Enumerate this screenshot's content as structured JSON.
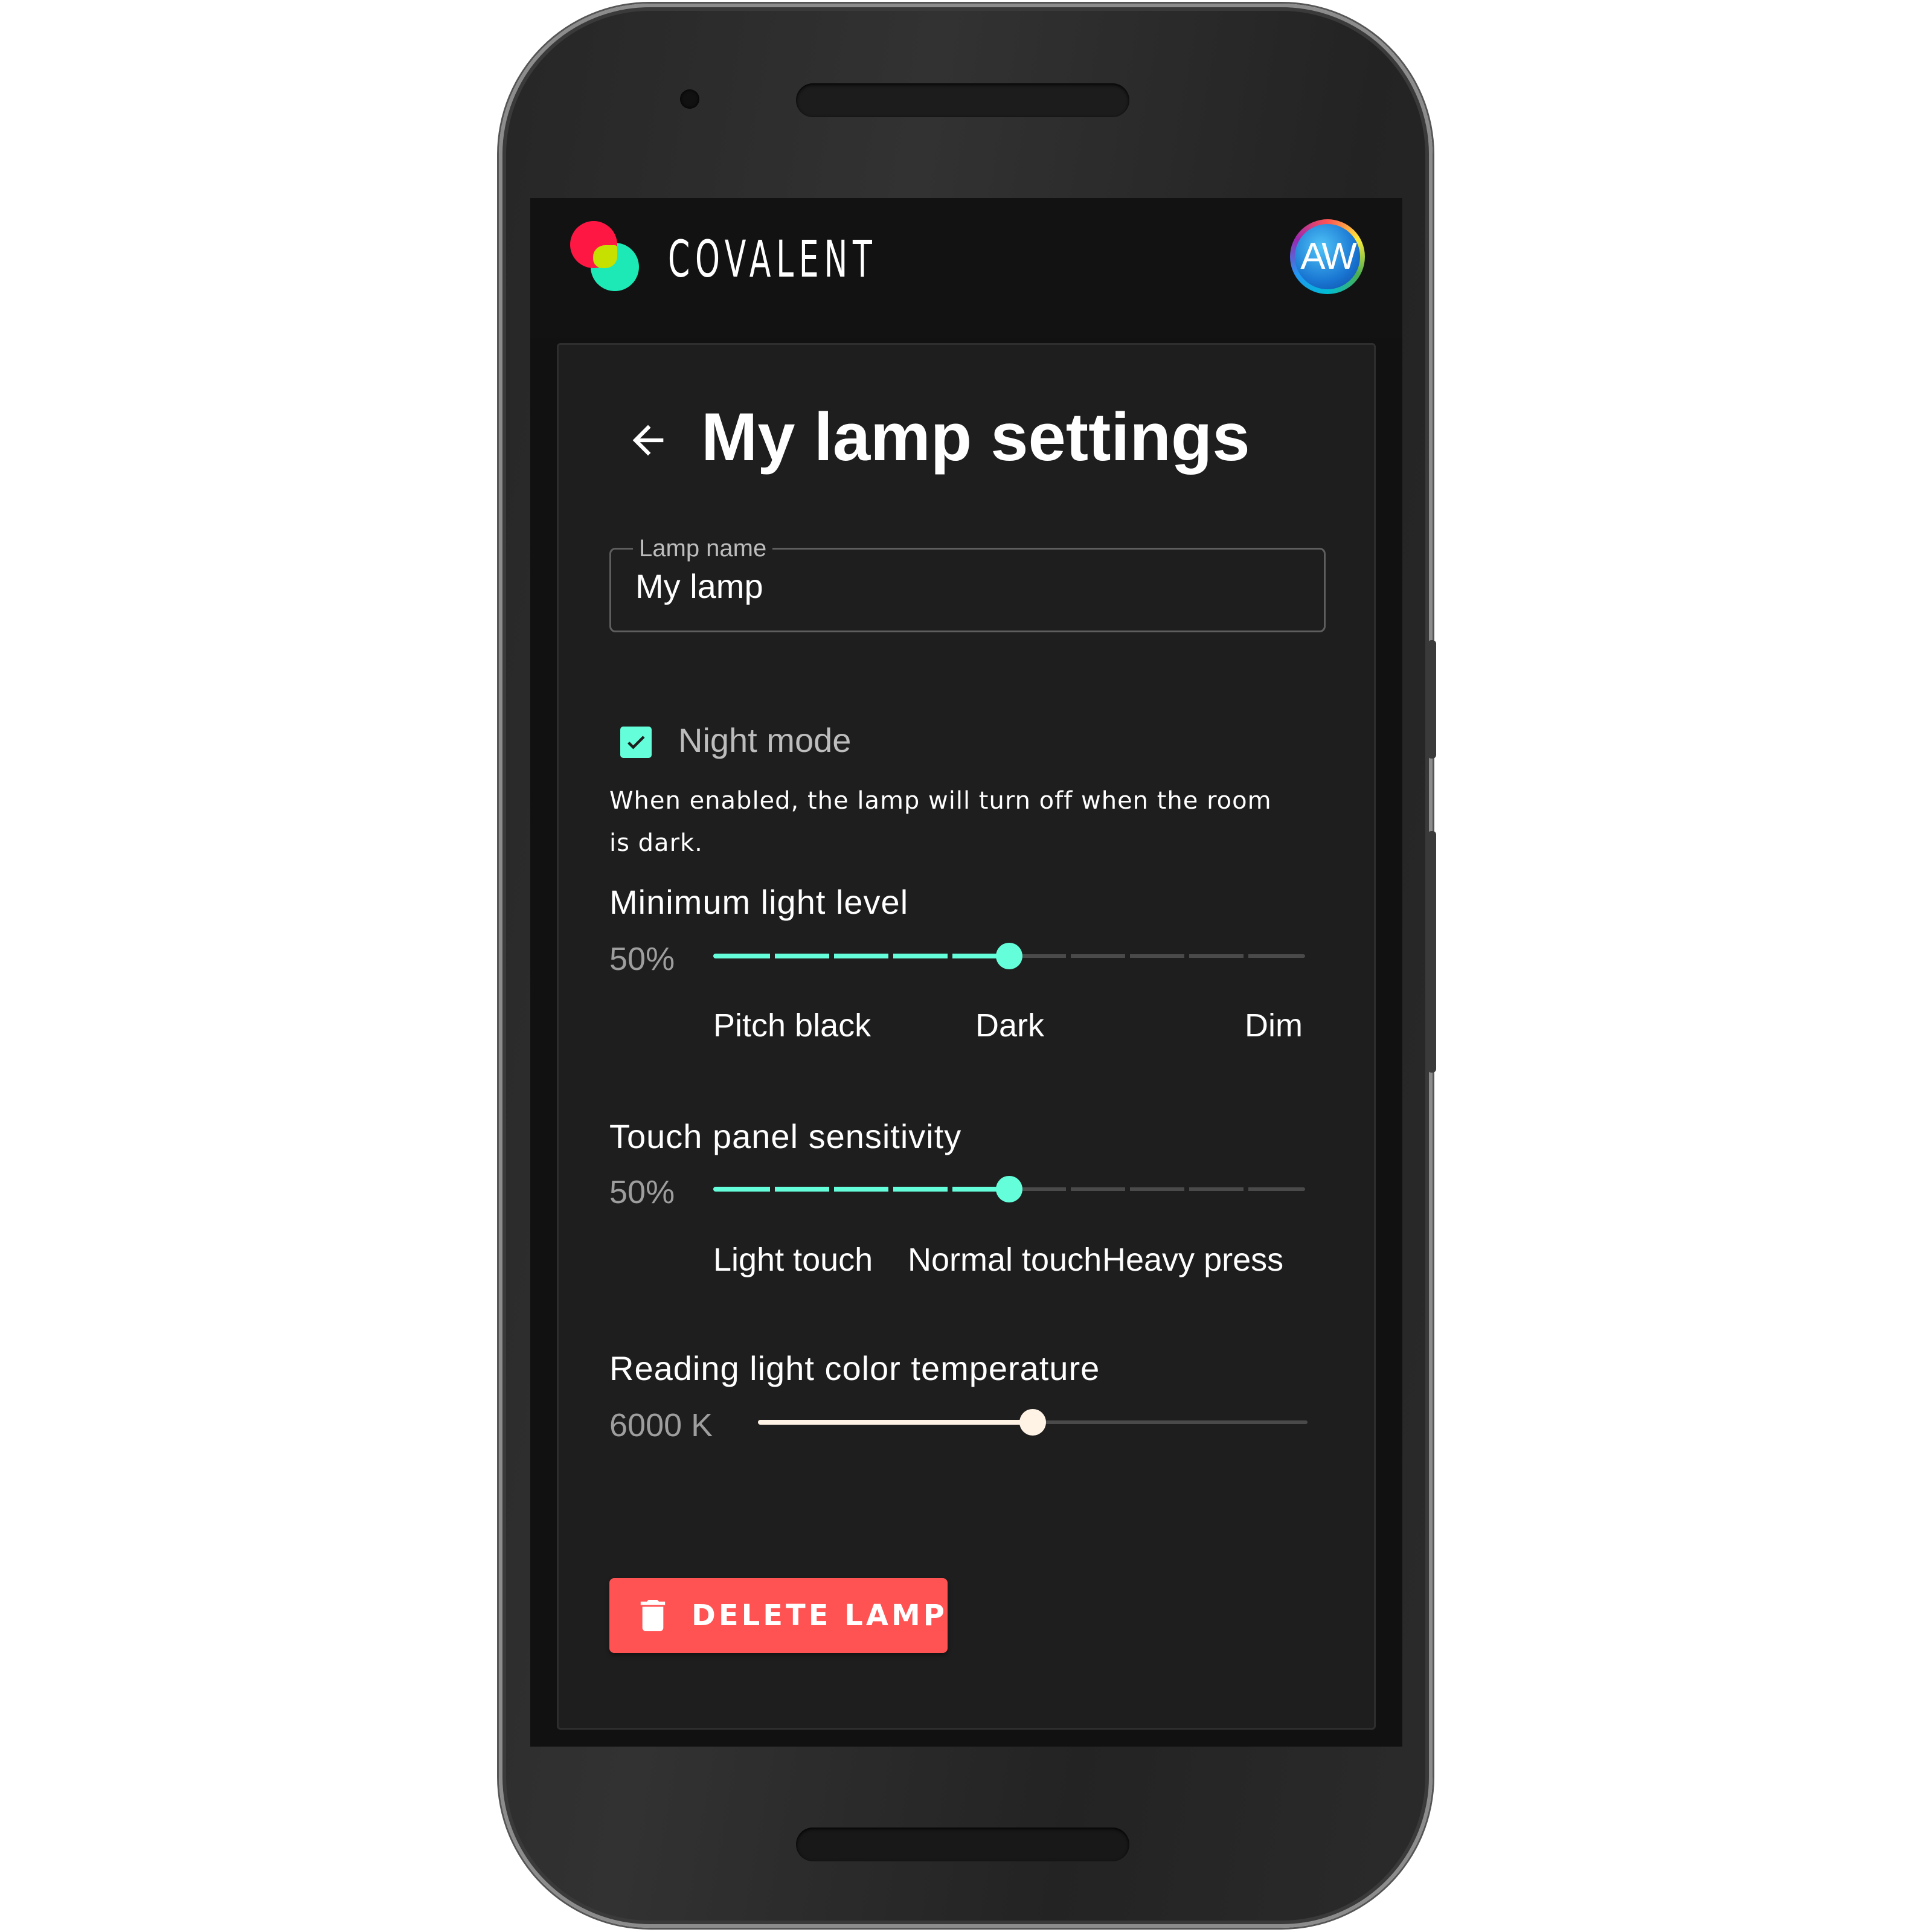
{
  "app": {
    "brand": "COVALENT",
    "avatar_initials": "AW",
    "avatar_icon": "user-avatar"
  },
  "page": {
    "title": "My lamp settings",
    "back_icon": "arrow-left-icon"
  },
  "lamp_name": {
    "label": "Lamp name",
    "value": "My lamp"
  },
  "night_mode": {
    "label": "Night mode",
    "checked": true,
    "hint": "When enabled, the lamp will turn off when the room is dark."
  },
  "min_light": {
    "title": "Minimum light level",
    "value": "50%",
    "fraction": 0.5,
    "ticks": 10,
    "labels": [
      "Pitch black",
      "Dark",
      "Dim"
    ]
  },
  "touch": {
    "title": "Touch panel sensitivity",
    "value": "50%",
    "fraction": 0.5,
    "ticks": 10,
    "labels": [
      "Light touch",
      "Normal touch",
      "Heavy press"
    ]
  },
  "color_temp": {
    "title": "Reading light color temperature",
    "value": "6000 K",
    "fraction": 0.5
  },
  "delete": {
    "label": "DELETE LAMP",
    "icon": "trash-icon"
  },
  "colors": {
    "accent": "#64ffda",
    "warn": "#ff5252",
    "warm": "#fff3e6"
  }
}
